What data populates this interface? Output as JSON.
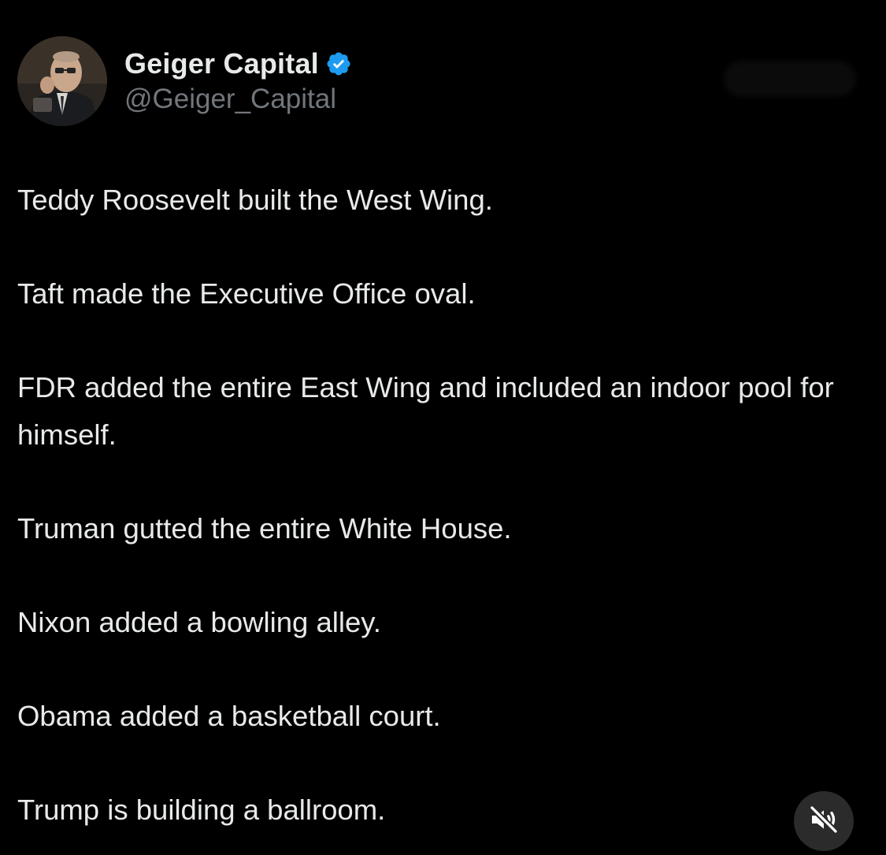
{
  "post": {
    "author": {
      "display_name": "Geiger Capital",
      "handle": "@Geiger_Capital",
      "verified": true,
      "verified_color": "#1d9bf0"
    },
    "lines": [
      "Teddy Roosevelt built the West Wing.",
      "Taft made the Executive Office oval.",
      "FDR added the entire East Wing and included an indoor pool for himself.",
      "Truman gutted the entire White House.",
      "Nixon added a bowling alley.",
      "Obama added a basketball court.",
      "Trump is building a ballroom."
    ]
  },
  "icons": {
    "verified": "verified-badge-icon",
    "mute": "speaker-muted-icon"
  },
  "colors": {
    "background": "#000000",
    "text_primary": "#e7e9ea",
    "text_secondary": "#71767b"
  }
}
